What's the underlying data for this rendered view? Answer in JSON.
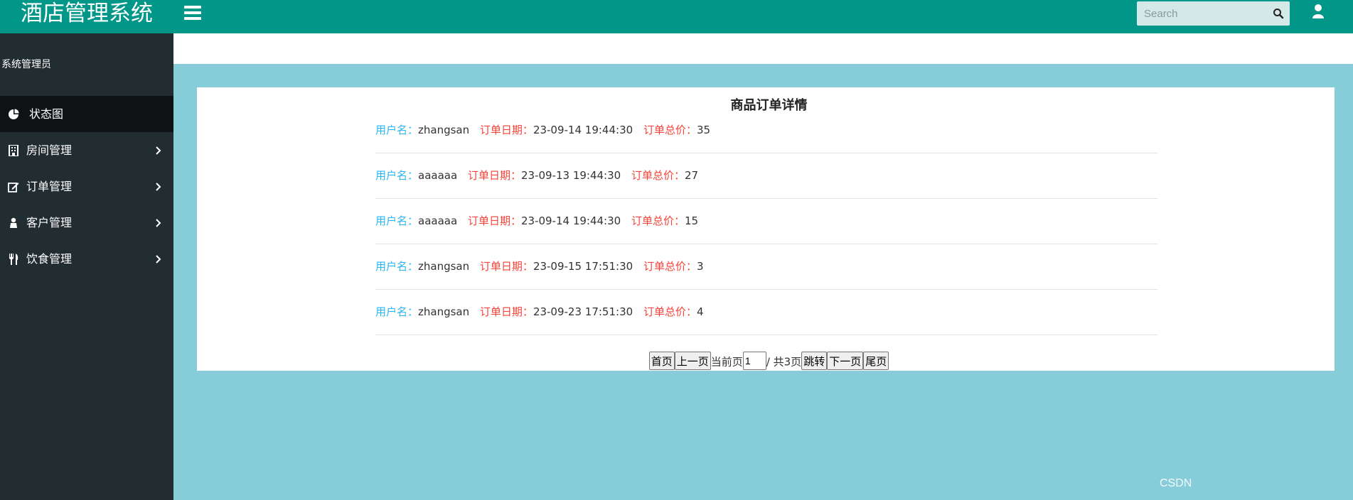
{
  "app": {
    "title": "酒店管理系统"
  },
  "search": {
    "placeholder": "Search"
  },
  "sidebar": {
    "user_role": "系统管理员",
    "items": [
      {
        "label": "状态图",
        "icon": "pie-chart-icon",
        "active": true
      },
      {
        "label": "房间管理",
        "icon": "building-icon"
      },
      {
        "label": "订单管理",
        "icon": "edit-icon"
      },
      {
        "label": "客户管理",
        "icon": "user-icon"
      },
      {
        "label": "饮食管理",
        "icon": "cutlery-icon"
      }
    ]
  },
  "panel": {
    "title": "商品订单详情",
    "labels": {
      "user": "用户名：",
      "date": "订单日期：",
      "total": "订单总价："
    },
    "orders": [
      {
        "user": "zhangsan",
        "date": "23-09-14 19:44:30",
        "total": "35"
      },
      {
        "user": "aaaaaa",
        "date": "23-09-13 19:44:30",
        "total": "27"
      },
      {
        "user": "aaaaaa",
        "date": "23-09-14 19:44:30",
        "total": "15"
      },
      {
        "user": "zhangsan",
        "date": "23-09-15 17:51:30",
        "total": "3"
      },
      {
        "user": "zhangsan",
        "date": "23-09-23 17:51:30",
        "total": "4"
      }
    ]
  },
  "pager": {
    "first": "首页",
    "prev": "上一页",
    "current_label": "当前页",
    "current_value": "1",
    "total_text": "/ 共3页",
    "jump": "跳转",
    "next": "下一页",
    "last": "尾页"
  },
  "watermark": "CSDN",
  "colors": {
    "topbar": "#009688",
    "sidebar": "#222d32",
    "background": "#86cdd9",
    "label_blue": "#29b6f6",
    "label_red": "#f44336"
  }
}
